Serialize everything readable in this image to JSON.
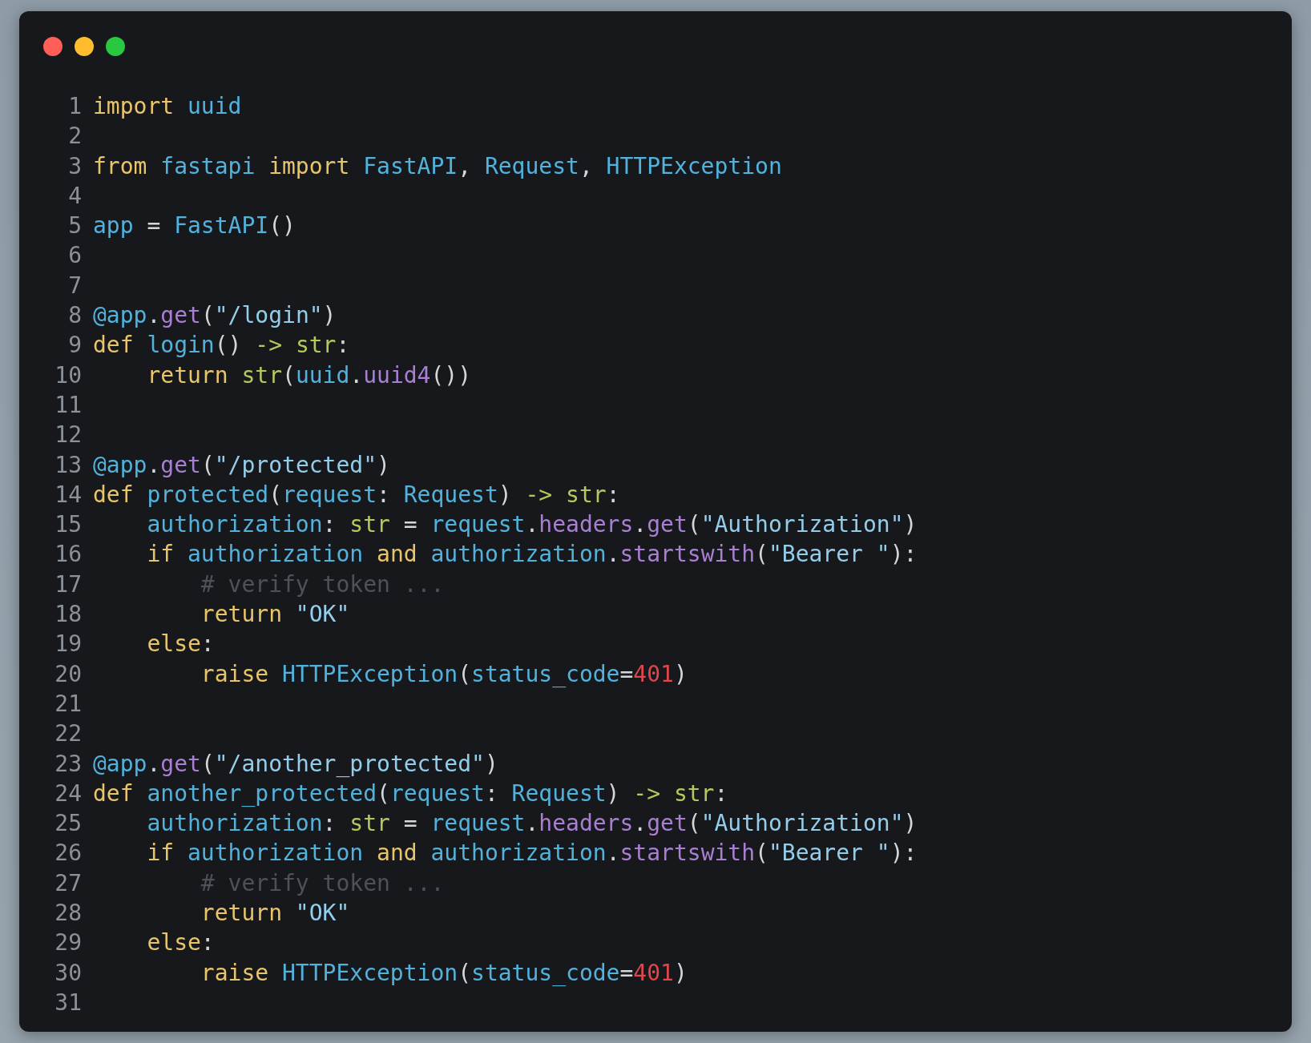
{
  "lines": [
    {
      "number": "1",
      "tokens": [
        {
          "kind": "kw",
          "text": "import"
        },
        {
          "kind": "id",
          "text": " uuid"
        }
      ]
    },
    {
      "number": "2"
    },
    {
      "number": "3",
      "tokens": [
        {
          "kind": "kw",
          "text": "from"
        },
        {
          "kind": "id",
          "text": " fastapi"
        },
        {
          "kind": "kw",
          "text": " import"
        },
        {
          "kind": "id",
          "text": " FastAPI"
        },
        {
          "kind": "plain",
          "text": ","
        },
        {
          "kind": "id",
          "text": " Request"
        },
        {
          "kind": "plain",
          "text": ","
        },
        {
          "kind": "id",
          "text": " HTTPException"
        }
      ]
    },
    {
      "number": "4"
    },
    {
      "number": "5",
      "tokens": [
        {
          "kind": "id",
          "text": "app"
        },
        {
          "kind": "plain",
          "text": " ="
        },
        {
          "kind": "id",
          "text": " FastAPI"
        },
        {
          "kind": "plain",
          "text": "()"
        }
      ]
    },
    {
      "number": "6"
    },
    {
      "number": "7"
    },
    {
      "number": "8",
      "tokens": [
        {
          "kind": "id",
          "text": "@app"
        },
        {
          "kind": "plain",
          "text": "."
        },
        {
          "kind": "fn",
          "text": "get"
        },
        {
          "kind": "plain",
          "text": "("
        },
        {
          "kind": "str",
          "text": "\"/login\""
        },
        {
          "kind": "plain",
          "text": ")"
        }
      ]
    },
    {
      "number": "9",
      "tokens": [
        {
          "kind": "kw",
          "text": "def"
        },
        {
          "kind": "id",
          "text": " login"
        },
        {
          "kind": "plain",
          "text": "()"
        },
        {
          "kind": "type",
          "text": " ->"
        },
        {
          "kind": "type",
          "text": " str"
        },
        {
          "kind": "plain",
          "text": ":"
        }
      ]
    },
    {
      "number": "10",
      "tokens": [
        {
          "kind": "kw",
          "text": "    return"
        },
        {
          "kind": "type",
          "text": " str"
        },
        {
          "kind": "plain",
          "text": "("
        },
        {
          "kind": "id",
          "text": "uuid"
        },
        {
          "kind": "plain",
          "text": "."
        },
        {
          "kind": "fn",
          "text": "uuid4"
        },
        {
          "kind": "plain",
          "text": "())"
        }
      ]
    },
    {
      "number": "11"
    },
    {
      "number": "12"
    },
    {
      "number": "13",
      "tokens": [
        {
          "kind": "id",
          "text": "@app"
        },
        {
          "kind": "plain",
          "text": "."
        },
        {
          "kind": "fn",
          "text": "get"
        },
        {
          "kind": "plain",
          "text": "("
        },
        {
          "kind": "str",
          "text": "\"/protected\""
        },
        {
          "kind": "plain",
          "text": ")"
        }
      ]
    },
    {
      "number": "14",
      "tokens": [
        {
          "kind": "kw",
          "text": "def"
        },
        {
          "kind": "id",
          "text": " protected"
        },
        {
          "kind": "plain",
          "text": "("
        },
        {
          "kind": "id",
          "text": "request"
        },
        {
          "kind": "plain",
          "text": ":"
        },
        {
          "kind": "id",
          "text": " Request"
        },
        {
          "kind": "plain",
          "text": ")"
        },
        {
          "kind": "type",
          "text": " ->"
        },
        {
          "kind": "type",
          "text": " str"
        },
        {
          "kind": "plain",
          "text": ":"
        }
      ]
    },
    {
      "number": "15",
      "tokens": [
        {
          "kind": "id",
          "text": "    authorization"
        },
        {
          "kind": "plain",
          "text": ":"
        },
        {
          "kind": "type",
          "text": " str"
        },
        {
          "kind": "plain",
          "text": " ="
        },
        {
          "kind": "id",
          "text": " request"
        },
        {
          "kind": "plain",
          "text": "."
        },
        {
          "kind": "fn",
          "text": "headers"
        },
        {
          "kind": "plain",
          "text": "."
        },
        {
          "kind": "fn",
          "text": "get"
        },
        {
          "kind": "plain",
          "text": "("
        },
        {
          "kind": "str",
          "text": "\"Authorization\""
        },
        {
          "kind": "plain",
          "text": ")"
        }
      ]
    },
    {
      "number": "16",
      "tokens": [
        {
          "kind": "kw",
          "text": "    if"
        },
        {
          "kind": "id",
          "text": " authorization"
        },
        {
          "kind": "kw",
          "text": " and"
        },
        {
          "kind": "id",
          "text": " authorization"
        },
        {
          "kind": "plain",
          "text": "."
        },
        {
          "kind": "fn",
          "text": "startswith"
        },
        {
          "kind": "plain",
          "text": "("
        },
        {
          "kind": "str",
          "text": "\"Bearer \""
        },
        {
          "kind": "plain",
          "text": "):"
        }
      ]
    },
    {
      "number": "17",
      "tokens": [
        {
          "kind": "comment",
          "text": "        # verify token ..."
        }
      ]
    },
    {
      "number": "18",
      "tokens": [
        {
          "kind": "kw",
          "text": "        return"
        },
        {
          "kind": "str",
          "text": " \"OK\""
        }
      ]
    },
    {
      "number": "19",
      "tokens": [
        {
          "kind": "kw",
          "text": "    else"
        },
        {
          "kind": "plain",
          "text": ":"
        }
      ]
    },
    {
      "number": "20",
      "tokens": [
        {
          "kind": "kw",
          "text": "        raise"
        },
        {
          "kind": "id",
          "text": " HTTPException"
        },
        {
          "kind": "plain",
          "text": "("
        },
        {
          "kind": "id",
          "text": "status_code"
        },
        {
          "kind": "plain",
          "text": "="
        },
        {
          "kind": "num",
          "text": "401"
        },
        {
          "kind": "plain",
          "text": ")"
        }
      ]
    },
    {
      "number": "21"
    },
    {
      "number": "22"
    },
    {
      "number": "23",
      "tokens": [
        {
          "kind": "id",
          "text": "@app"
        },
        {
          "kind": "plain",
          "text": "."
        },
        {
          "kind": "fn",
          "text": "get"
        },
        {
          "kind": "plain",
          "text": "("
        },
        {
          "kind": "str",
          "text": "\"/another_protected\""
        },
        {
          "kind": "plain",
          "text": ")"
        }
      ]
    },
    {
      "number": "24",
      "tokens": [
        {
          "kind": "kw",
          "text": "def"
        },
        {
          "kind": "id",
          "text": " another_protected"
        },
        {
          "kind": "plain",
          "text": "("
        },
        {
          "kind": "id",
          "text": "request"
        },
        {
          "kind": "plain",
          "text": ":"
        },
        {
          "kind": "id",
          "text": " Request"
        },
        {
          "kind": "plain",
          "text": ")"
        },
        {
          "kind": "type",
          "text": " ->"
        },
        {
          "kind": "type",
          "text": " str"
        },
        {
          "kind": "plain",
          "text": ":"
        }
      ]
    },
    {
      "number": "25",
      "tokens": [
        {
          "kind": "id",
          "text": "    authorization"
        },
        {
          "kind": "plain",
          "text": ":"
        },
        {
          "kind": "type",
          "text": " str"
        },
        {
          "kind": "plain",
          "text": " ="
        },
        {
          "kind": "id",
          "text": " request"
        },
        {
          "kind": "plain",
          "text": "."
        },
        {
          "kind": "fn",
          "text": "headers"
        },
        {
          "kind": "plain",
          "text": "."
        },
        {
          "kind": "fn",
          "text": "get"
        },
        {
          "kind": "plain",
          "text": "("
        },
        {
          "kind": "str",
          "text": "\"Authorization\""
        },
        {
          "kind": "plain",
          "text": ")"
        }
      ]
    },
    {
      "number": "26",
      "tokens": [
        {
          "kind": "kw",
          "text": "    if"
        },
        {
          "kind": "id",
          "text": " authorization"
        },
        {
          "kind": "kw",
          "text": " and"
        },
        {
          "kind": "id",
          "text": " authorization"
        },
        {
          "kind": "plain",
          "text": "."
        },
        {
          "kind": "fn",
          "text": "startswith"
        },
        {
          "kind": "plain",
          "text": "("
        },
        {
          "kind": "str",
          "text": "\"Bearer \""
        },
        {
          "kind": "plain",
          "text": "):"
        }
      ]
    },
    {
      "number": "27",
      "tokens": [
        {
          "kind": "comment",
          "text": "        # verify token ..."
        }
      ]
    },
    {
      "number": "28",
      "tokens": [
        {
          "kind": "kw",
          "text": "        return"
        },
        {
          "kind": "str",
          "text": " \"OK\""
        }
      ]
    },
    {
      "number": "29",
      "tokens": [
        {
          "kind": "kw",
          "text": "    else"
        },
        {
          "kind": "plain",
          "text": ":"
        }
      ]
    },
    {
      "number": "30",
      "tokens": [
        {
          "kind": "kw",
          "text": "        raise"
        },
        {
          "kind": "id",
          "text": " HTTPException"
        },
        {
          "kind": "plain",
          "text": "("
        },
        {
          "kind": "id",
          "text": "status_code"
        },
        {
          "kind": "plain",
          "text": "="
        },
        {
          "kind": "num",
          "text": "401"
        },
        {
          "kind": "plain",
          "text": ")"
        }
      ]
    },
    {
      "number": "31"
    }
  ]
}
